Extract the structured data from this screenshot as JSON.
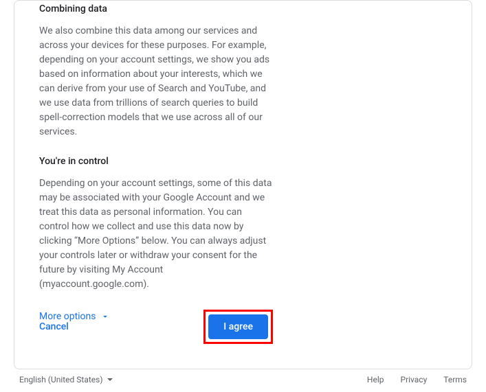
{
  "sections": {
    "combining": {
      "heading": "Combining data",
      "body": "We also combine this data among our services and across your devices for these purposes. For example, depending on your account settings, we show you ads based on information about your interests, which we can derive from your use of Search and YouTube, and we use data from trillions of search queries to build spell-correction models that we use across all of our services."
    },
    "control": {
      "heading": "You're in control",
      "body": "Depending on your account settings, some of this data may be associated with your Google Account and we treat this data as personal information. You can control how we collect and use this data now by clicking “More Options” below. You can always adjust your controls later or withdraw your consent for the future by visiting My Account (myaccount.google.com)."
    }
  },
  "more_options_label": "More options",
  "buttons": {
    "cancel": "Cancel",
    "agree": "I agree"
  },
  "footer": {
    "language": "English (United States)",
    "links": {
      "help": "Help",
      "privacy": "Privacy",
      "terms": "Terms"
    }
  }
}
